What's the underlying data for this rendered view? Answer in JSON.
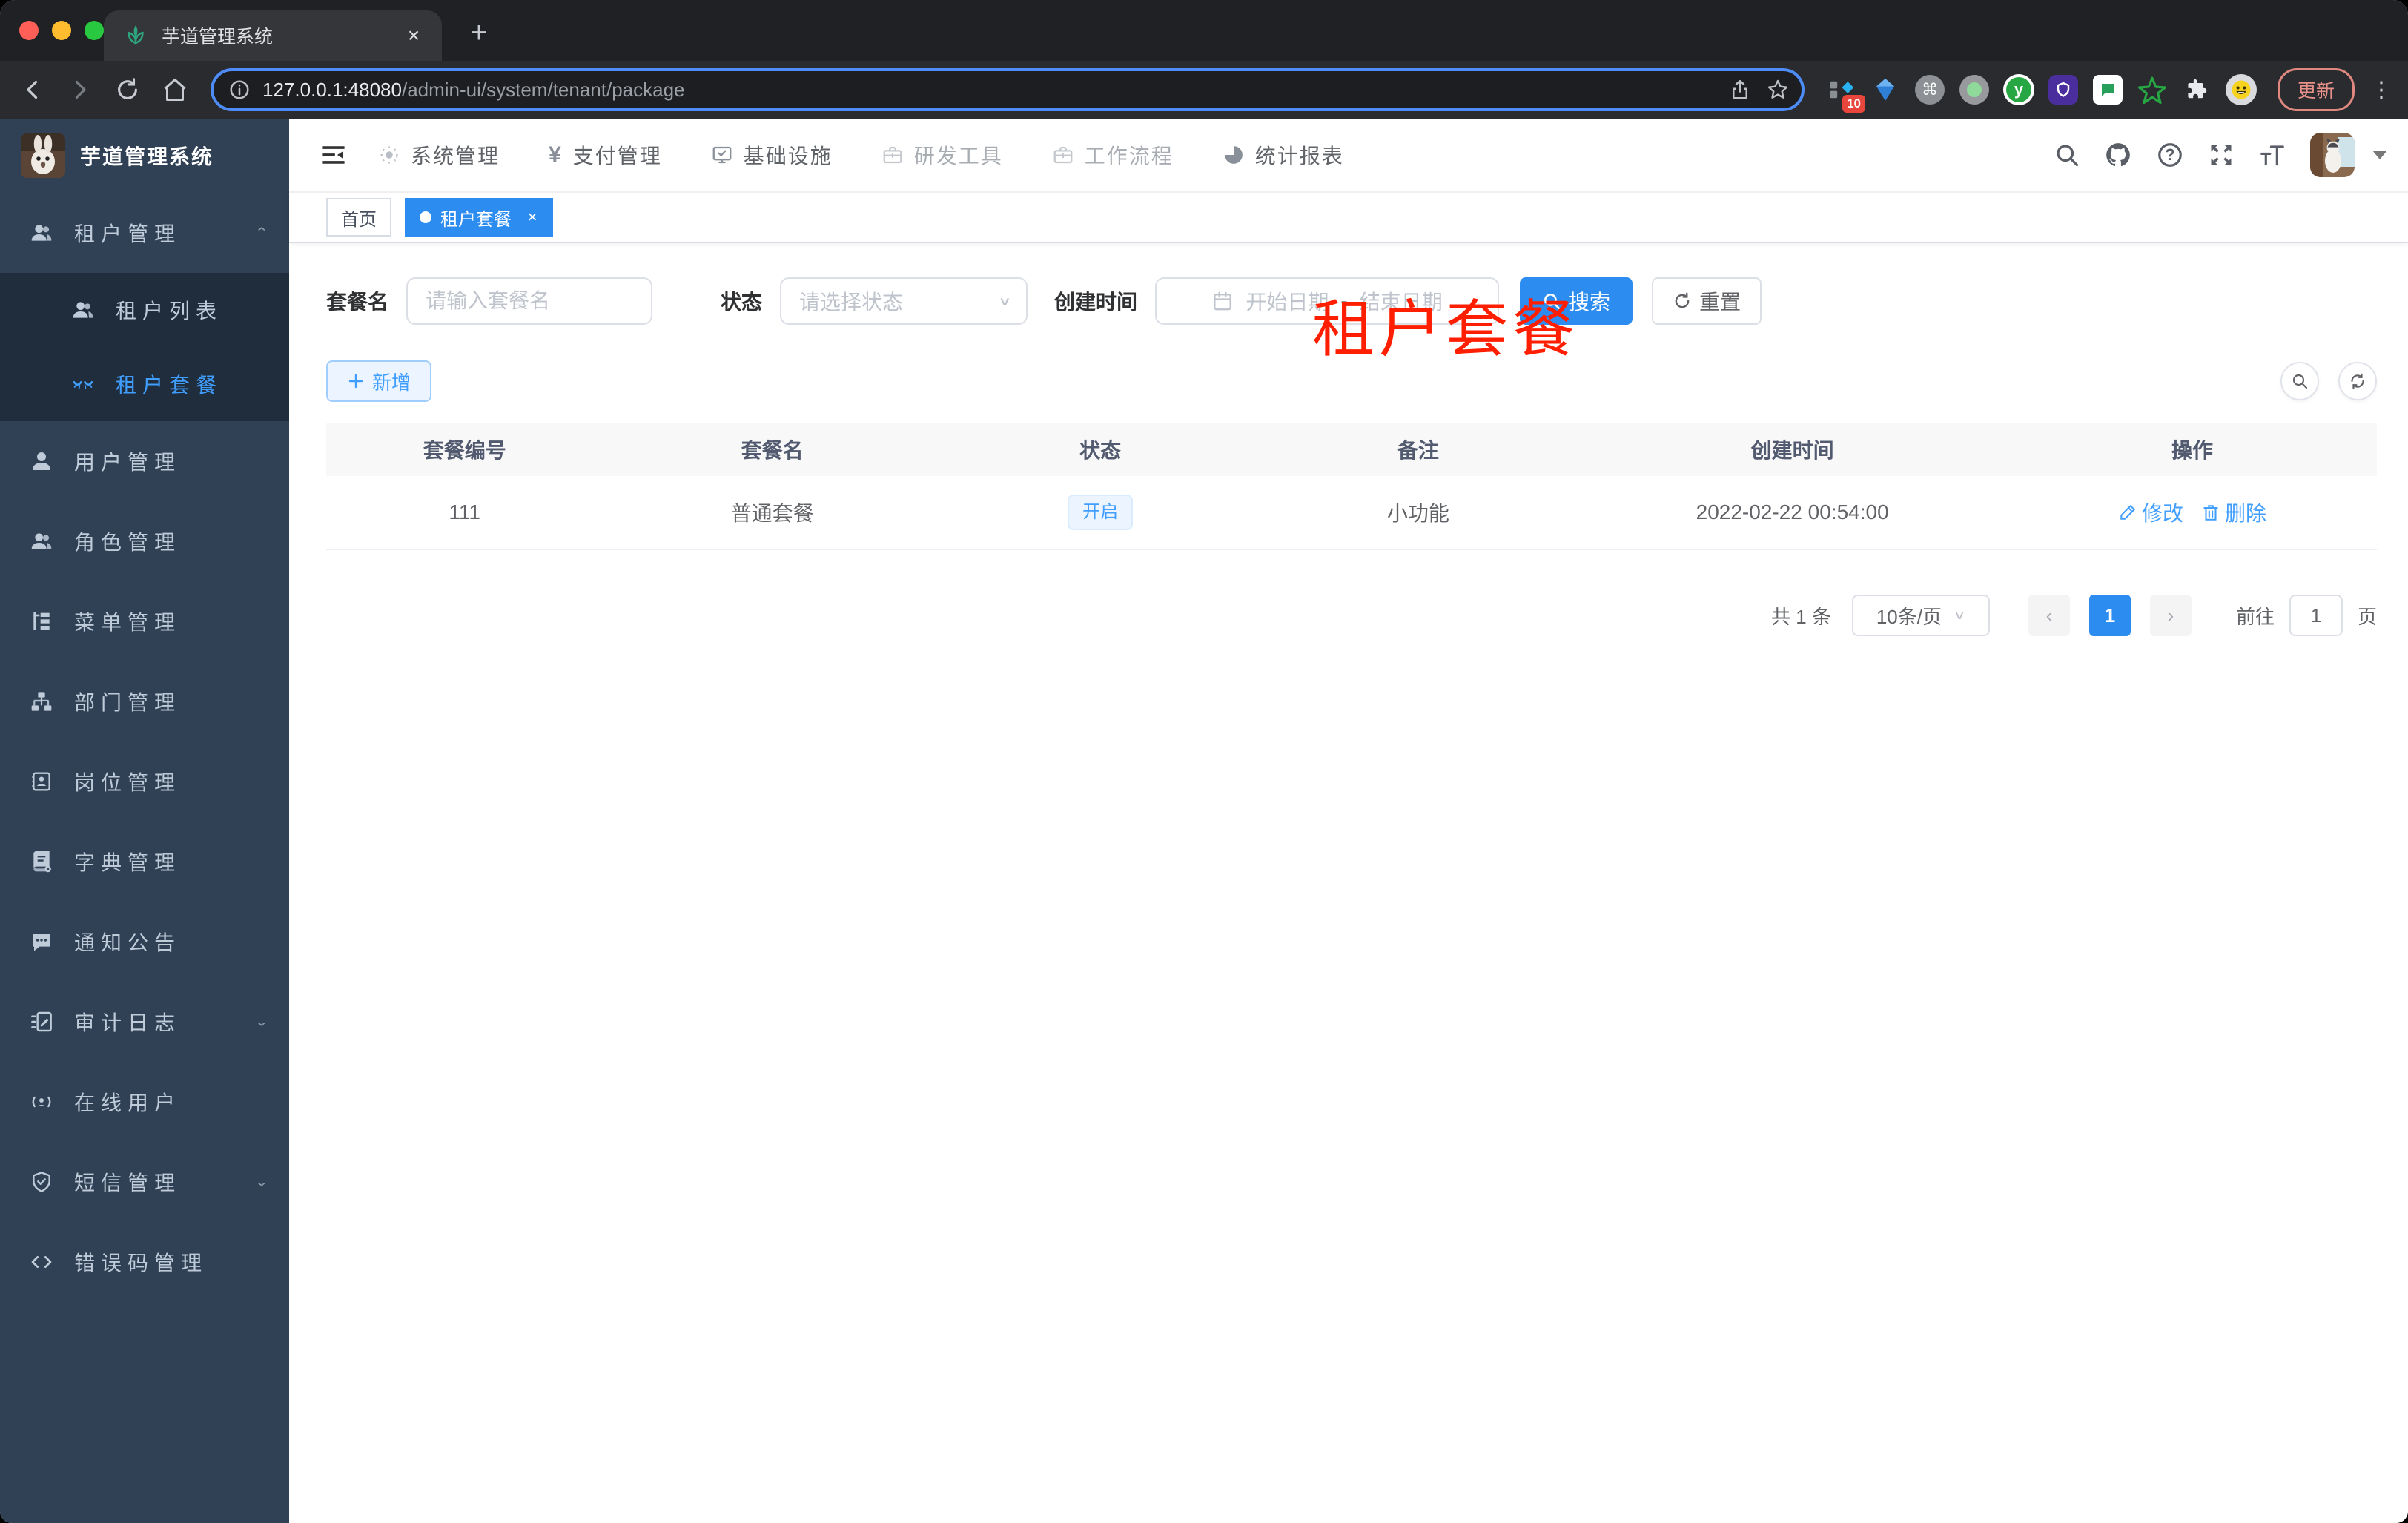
{
  "browser": {
    "tab": {
      "title": "芋道管理系统",
      "close_glyph": "×",
      "newtab_glyph": "+"
    },
    "url": {
      "host": "127.0.0.1:48080",
      "path": "/admin-ui/system/tenant/package"
    },
    "extensions_badge": "10",
    "update_button": "更新",
    "menu_glyph": "⋮"
  },
  "sidebar": {
    "logo_title": "芋道管理系统",
    "menu": [
      {
        "label": "租户管理",
        "icon": "peoples-icon",
        "arrow": "up"
      },
      {
        "label": "租户列表",
        "icon": "peoples-icon"
      },
      {
        "label": "租户套餐",
        "icon": "tenant-package-icon"
      },
      {
        "label": "用户管理",
        "icon": "user-icon"
      },
      {
        "label": "角色管理",
        "icon": "peoples-icon"
      },
      {
        "label": "菜单管理",
        "icon": "tree-table-icon"
      },
      {
        "label": "部门管理",
        "icon": "tree-icon"
      },
      {
        "label": "岗位管理",
        "icon": "post-icon"
      },
      {
        "label": "字典管理",
        "icon": "dict-icon"
      },
      {
        "label": "通知公告",
        "icon": "message-icon"
      },
      {
        "label": "审计日志",
        "icon": "log-icon",
        "arrow": "down"
      },
      {
        "label": "在线用户",
        "icon": "online-icon"
      },
      {
        "label": "短信管理",
        "icon": "sms-icon",
        "arrow": "down"
      },
      {
        "label": "错误码管理",
        "icon": "code-icon"
      }
    ],
    "arrow_up_glyph": "⌃",
    "arrow_down_glyph": "⌄"
  },
  "topnav": {
    "items": [
      {
        "label": "系统管理"
      },
      {
        "label": "支付管理",
        "glyph": "¥"
      },
      {
        "label": "基础设施"
      },
      {
        "label": "研发工具"
      },
      {
        "label": "工作流程"
      },
      {
        "label": "统计报表"
      }
    ]
  },
  "tags": {
    "home": "首页",
    "active": "租户套餐",
    "close_glyph": "×"
  },
  "page_title_overlay": "租户套餐",
  "filters": {
    "name_label": "套餐名",
    "name_placeholder": "请输入套餐名",
    "status_label": "状态",
    "status_placeholder": "请选择状态",
    "date_label": "创建时间",
    "date_start": "开始日期",
    "date_separator": "-",
    "date_end": "结束日期",
    "search": "搜索",
    "reset": "重置",
    "chevron_glyph": "∨"
  },
  "toolbar": {
    "add": "新增",
    "plus_glyph": "＋"
  },
  "table": {
    "columns": [
      "套餐编号",
      "套餐名",
      "状态",
      "备注",
      "创建时间",
      "操作"
    ],
    "row": {
      "id": "111",
      "name": "普通套餐",
      "status": "开启",
      "remark": "小功能",
      "created": "2022-02-22 00:54:00",
      "edit": "修改",
      "delete": "删除"
    }
  },
  "pagination": {
    "total": "共 1 条",
    "page_size": "10条/页",
    "prev_glyph": "‹",
    "next_glyph": "›",
    "page": "1",
    "goto": "前往",
    "goto_value": "1",
    "unit": "页",
    "chevron_glyph": "∨"
  },
  "misc": {
    "help_glyph": "?"
  },
  "colors": {
    "primary": "#2d8cf0",
    "link": "#409eff",
    "red_title": "#ff1e00",
    "sidebar_bg": "#304156",
    "submenu_bg": "#1f2d3d"
  }
}
